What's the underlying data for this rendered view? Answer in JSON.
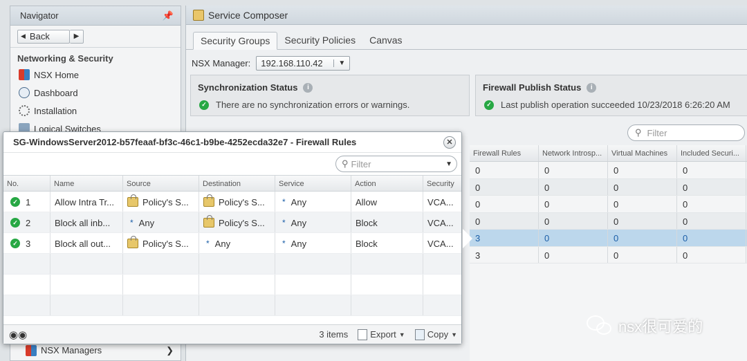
{
  "navigator": {
    "title": "Navigator",
    "back_label": "Back",
    "section": "Networking & Security",
    "items": [
      {
        "label": "NSX Home",
        "icon": "nsx-home-icon"
      },
      {
        "label": "Dashboard",
        "icon": "dashboard-icon"
      },
      {
        "label": "Installation",
        "icon": "installation-icon"
      },
      {
        "label": "Logical Switches",
        "icon": "logical-switches-icon"
      }
    ],
    "bottom_item": "NSX Managers"
  },
  "main": {
    "title": "Service Composer",
    "tabs": [
      "Security Groups",
      "Security Policies",
      "Canvas"
    ],
    "manager_label": "NSX Manager:",
    "manager_value": "192.168.110.42",
    "sync": {
      "title": "Synchronization Status",
      "text": "There are no synchronization errors or warnings."
    },
    "firewall": {
      "title": "Firewall Publish Status",
      "text": "Last publish operation succeeded 10/23/2018 6:26:20 AM"
    },
    "filter_placeholder": "Filter",
    "bg_columns": [
      "Firewall Rules",
      "Network Introsp...",
      "Virtual Machines",
      "Included Securi..."
    ],
    "bg_rows": [
      [
        "0",
        "0",
        "0",
        "0"
      ],
      [
        "0",
        "0",
        "0",
        "0"
      ],
      [
        "0",
        "0",
        "0",
        "0"
      ],
      [
        "0",
        "0",
        "0",
        "0"
      ],
      [
        "3",
        "0",
        "0",
        "0"
      ],
      [
        "3",
        "0",
        "0",
        "0"
      ]
    ]
  },
  "popup": {
    "title": "SG-WindowsServer2012-b57feaaf-bf3c-46c1-b9be-4252ecda32e7 - Firewall Rules",
    "filter_placeholder": "Filter",
    "columns": [
      "No.",
      "Name",
      "Source",
      "Destination",
      "Service",
      "Action",
      "Security"
    ],
    "rows": [
      {
        "no": "1",
        "name": "Allow Intra Tr...",
        "source": "Policy's S...",
        "source_icon": "policy",
        "destination": "Policy's S...",
        "destination_icon": "policy",
        "service": "Any",
        "action": "Allow",
        "security": "VCA..."
      },
      {
        "no": "2",
        "name": "Block all inb...",
        "source": "Any",
        "source_icon": "star",
        "destination": "Policy's S...",
        "destination_icon": "policy",
        "service": "Any",
        "action": "Block",
        "security": "VCA..."
      },
      {
        "no": "3",
        "name": "Block all out...",
        "source": "Policy's S...",
        "source_icon": "policy",
        "destination": "Any",
        "destination_icon": "star",
        "service": "Any",
        "action": "Block",
        "security": "VCA..."
      }
    ],
    "item_count": "3 items",
    "export_label": "Export",
    "copy_label": "Copy"
  },
  "watermark": "nsx很可爱的"
}
